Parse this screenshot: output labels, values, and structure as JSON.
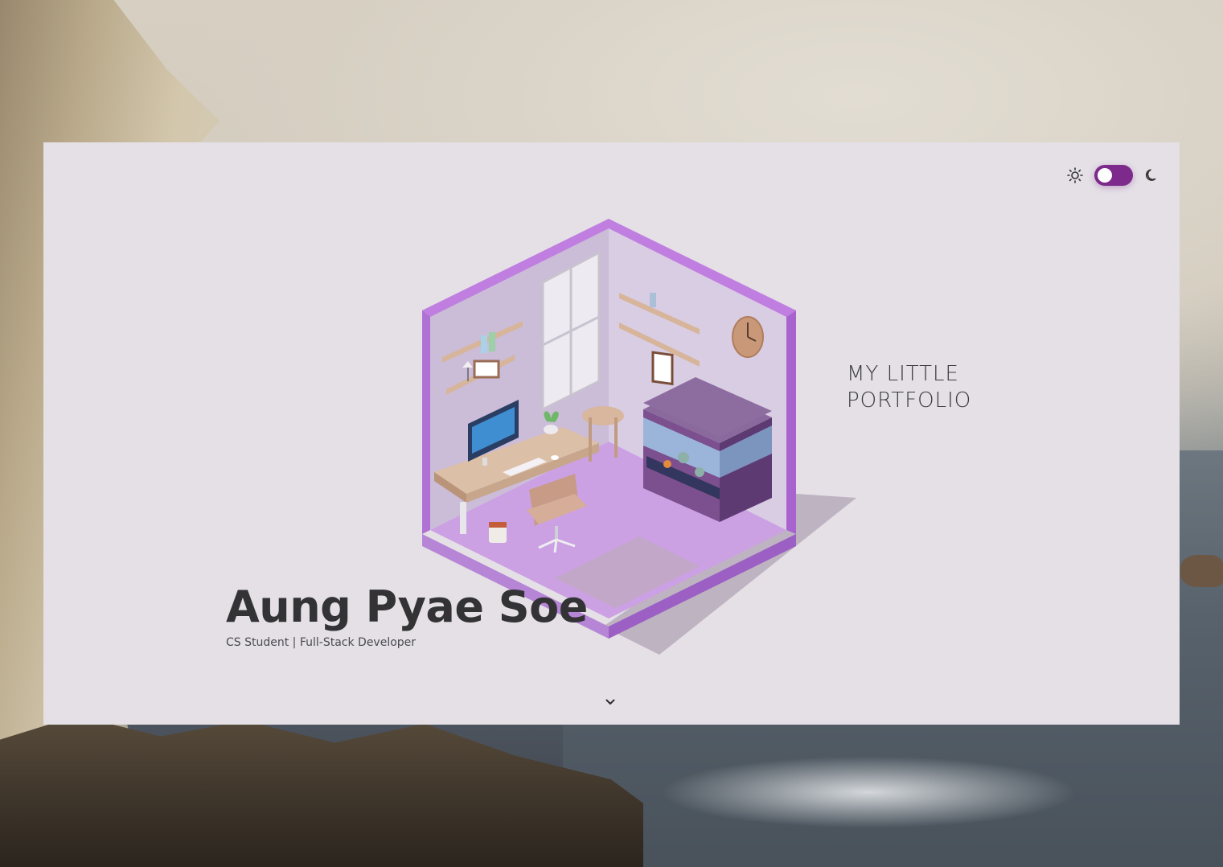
{
  "header": {
    "theme_toggle": {
      "light_icon": "sun-icon",
      "dark_icon": "moon-icon",
      "state": "light",
      "accent_color": "#7d2a8c"
    }
  },
  "hero": {
    "tagline_line1": "MY LITTLE",
    "tagline_line2": "PORTFOLIO",
    "name": "Aung Pyae Soe",
    "subtitle": "CS Student | Full-Stack Developer",
    "scroll_icon": "chevron-down-icon"
  },
  "colors": {
    "page_background": "#e4e0e6",
    "room_purple": "#c69be0",
    "text_dark": "#333336"
  }
}
